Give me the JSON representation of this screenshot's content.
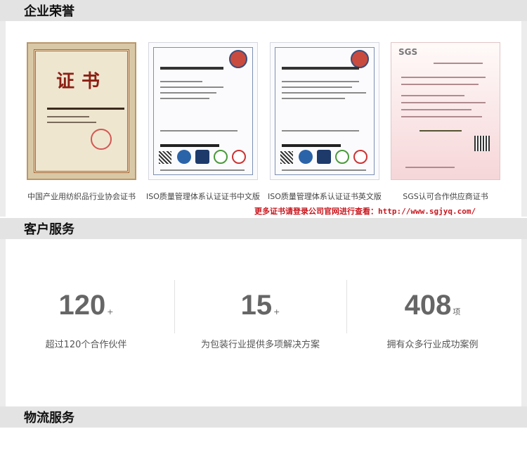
{
  "sections": {
    "honor": "企业荣誉",
    "service": "客户服务",
    "logistics": "物流服务"
  },
  "certificates": [
    {
      "caption": "中国产业用纺织品行业协会证书",
      "title": "证书"
    },
    {
      "caption": "ISO质量管理体系认证证书中文版"
    },
    {
      "caption": "ISO质量管理体系认证证书英文版"
    },
    {
      "caption": "SGS认可合作供应商证书",
      "brand": "SGS"
    }
  ],
  "more_link": "更多证书请登录公司官网进行查看：http://www.sgjyq.com/",
  "stats": [
    {
      "value": "120",
      "suffix": "+",
      "label": "超过120个合作伙伴"
    },
    {
      "value": "15",
      "suffix": "+",
      "label": "为包装行业提供多项解决方案"
    },
    {
      "value": "408",
      "suffix": "项",
      "label": "拥有众多行业成功案例"
    }
  ]
}
